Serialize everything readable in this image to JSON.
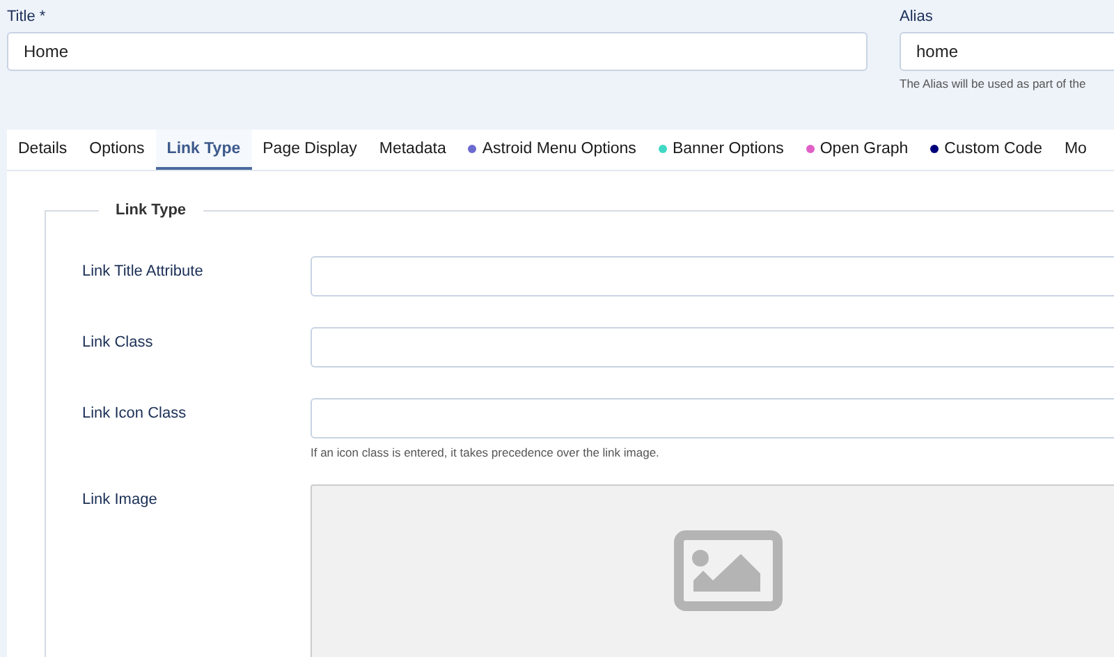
{
  "title_field": {
    "label": "Title *",
    "value": "Home"
  },
  "alias_field": {
    "label": "Alias",
    "value": "home",
    "help": "The Alias will be used as part of the"
  },
  "tabs": [
    {
      "label": "Details",
      "selected": false
    },
    {
      "label": "Options",
      "selected": false
    },
    {
      "label": "Link Type",
      "selected": true
    },
    {
      "label": "Page Display",
      "selected": false
    },
    {
      "label": "Metadata",
      "selected": false
    },
    {
      "label": "Astroid Menu Options",
      "selected": false,
      "color": "#6a6ad0"
    },
    {
      "label": "Banner Options",
      "selected": false,
      "color": "#40d8c4"
    },
    {
      "label": "Open Graph",
      "selected": false,
      "color": "#e060c8"
    },
    {
      "label": "Custom Code",
      "selected": false,
      "color": "#00007a"
    },
    {
      "label": "Mo",
      "selected": false
    }
  ],
  "fieldset": {
    "legend": "Link Type",
    "fields": [
      {
        "kind": "text",
        "label": "Link Title Attribute"
      },
      {
        "kind": "text",
        "label": "Link Class"
      },
      {
        "kind": "text",
        "label": "Link Icon Class",
        "help": "If an icon class is entered, it takes precedence over the link image."
      },
      {
        "kind": "image",
        "label": "Link Image"
      }
    ]
  }
}
